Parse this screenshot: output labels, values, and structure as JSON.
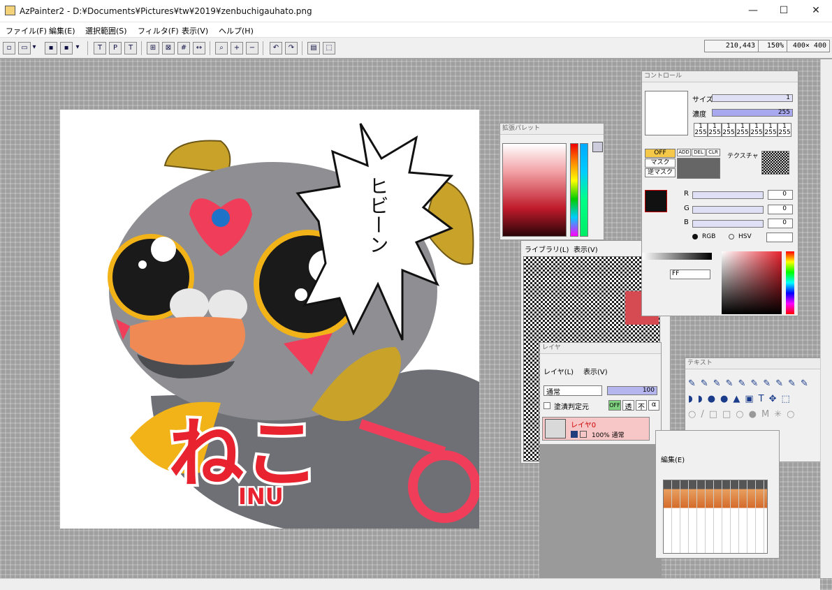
{
  "window": {
    "title": "AzPainter2 - D:¥Documents¥Pictures¥tw¥2019¥zenbuchigauhato.png",
    "minimize": "—",
    "maximize": "☐",
    "close": "✕"
  },
  "menu": [
    "ファイル(F)",
    "編集(E)",
    "選択範囲(S)",
    "フィルタ(F)",
    "表示(V)",
    "ヘルプ(H)"
  ],
  "status": {
    "coords": "210,443",
    "zoom": "150%",
    "size": "400× 400"
  },
  "artwork": {
    "speech": "ヒビーン",
    "logo_main": "ねこ",
    "logo_sub": "INU"
  },
  "palette_panel": {
    "title": "拡張パレット"
  },
  "library_panel": {
    "tab_library": "ライブラリ(L)",
    "tab_view": "表示(V)"
  },
  "control_panel": {
    "title": "コントロール",
    "size_label": "サイズ",
    "size_value": "1",
    "density_label": "濃度",
    "density_value": "255",
    "density_presets": [
      "1",
      "1",
      "1",
      "1",
      "1",
      "1",
      "1"
    ],
    "density_preset_sub": [
      "255",
      "255",
      "255",
      "255",
      "255",
      "255",
      "255"
    ],
    "mask_off": "OFF",
    "mask": "マスク",
    "mask_inverse": "逆マスク",
    "add": "ADD",
    "del": "DEL",
    "clr": "CLR",
    "texture": "テクスチャ",
    "r_label": "R",
    "g_label": "G",
    "b_label": "B",
    "r_value": "0",
    "g_value": "0",
    "b_value": "0",
    "mode_rgb": "RGB",
    "mode_hsv": "HSV",
    "ff": "FF"
  },
  "layer_panel": {
    "title": "レイヤ",
    "tab_layer": "レイヤ(L)",
    "tab_view": "表示(V)",
    "blend": "通常",
    "opacity": "100",
    "fill_ref": "塗潰判定元",
    "off": "OFF",
    "trans": "透",
    "non": "不",
    "alpha": "α",
    "layer_name": "レイヤ0",
    "layer_info": "100% 通常"
  },
  "text_panel": {
    "title": "テキスト"
  },
  "edit_panel": {
    "tab_edit": "編集(E)"
  },
  "colors": {
    "accent_red": "#e8222e",
    "gold": "#c9a22a",
    "grey": "#8f8f93",
    "panel_pink": "#f7c6c6"
  }
}
